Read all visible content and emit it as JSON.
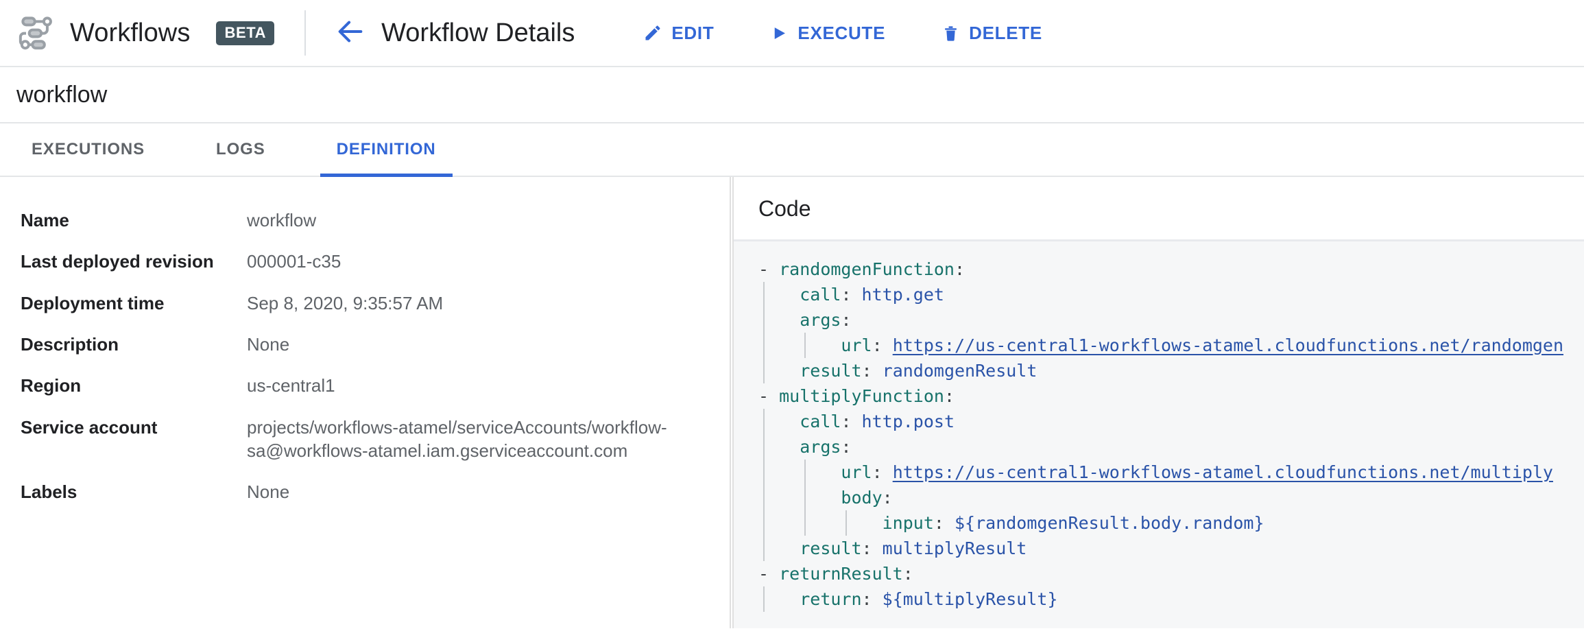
{
  "header": {
    "brand": "Workflows",
    "badge": "BETA",
    "page_title": "Workflow Details",
    "back_icon": "arrow-left-icon",
    "logo_icon": "workflows-logo-icon",
    "accent_color": "#3367d6",
    "badge_color": "#44565f",
    "actions": [
      {
        "label": "EDIT",
        "icon": "pencil-icon"
      },
      {
        "label": "EXECUTE",
        "icon": "play-icon"
      },
      {
        "label": "DELETE",
        "icon": "trash-icon"
      }
    ]
  },
  "workflow": {
    "title": "workflow"
  },
  "tabs": [
    {
      "label": "EXECUTIONS",
      "active": false
    },
    {
      "label": "LOGS",
      "active": false
    },
    {
      "label": "DEFINITION",
      "active": true
    }
  ],
  "details": {
    "rows": [
      {
        "label": "Name",
        "value": "workflow"
      },
      {
        "label": "Last deployed revision",
        "value": "000001-c35"
      },
      {
        "label": "Deployment time",
        "value": "Sep 8, 2020, 9:35:57 AM"
      },
      {
        "label": "Description",
        "value": "None"
      },
      {
        "label": "Region",
        "value": "us-central1"
      },
      {
        "label": "Service account",
        "value": "projects/workflows-atamel/serviceAccounts/workflow-sa@workflows-atamel.iam.gserviceaccount.com"
      },
      {
        "label": "Labels",
        "value": "None"
      }
    ]
  },
  "code_panel": {
    "title": "Code",
    "language": "yaml",
    "lines": [
      {
        "indent": 0,
        "text": "- randomgenFunction:"
      },
      {
        "indent": 1,
        "text": "call: http.get"
      },
      {
        "indent": 1,
        "text": "args:"
      },
      {
        "indent": 2,
        "text": "url: https://us-central1-workflows-atamel.cloudfunctions.net/randomgen"
      },
      {
        "indent": 1,
        "text": "result: randomgenResult"
      },
      {
        "indent": 0,
        "text": "- multiplyFunction:"
      },
      {
        "indent": 1,
        "text": "call: http.post"
      },
      {
        "indent": 1,
        "text": "args:"
      },
      {
        "indent": 2,
        "text": "url: https://us-central1-workflows-atamel.cloudfunctions.net/multiply"
      },
      {
        "indent": 2,
        "text": "body:"
      },
      {
        "indent": 3,
        "text": "input: ${randomgenResult.body.random}"
      },
      {
        "indent": 1,
        "text": "result: multiplyResult"
      },
      {
        "indent": 0,
        "text": "- returnResult:"
      },
      {
        "indent": 1,
        "text": "return: ${multiplyResult}"
      }
    ],
    "urls": {
      "randomgen": "https://us-central1-workflows-atamel.cloudfunctions.net/randomgen",
      "multiply": "https://us-central1-workflows-atamel.cloudfunctions.net/multiply"
    },
    "syntax_colors": {
      "key": "#17726a",
      "value": "#2a53a8",
      "punctuation": "#3c4043",
      "background": "#f6f7f8"
    }
  }
}
